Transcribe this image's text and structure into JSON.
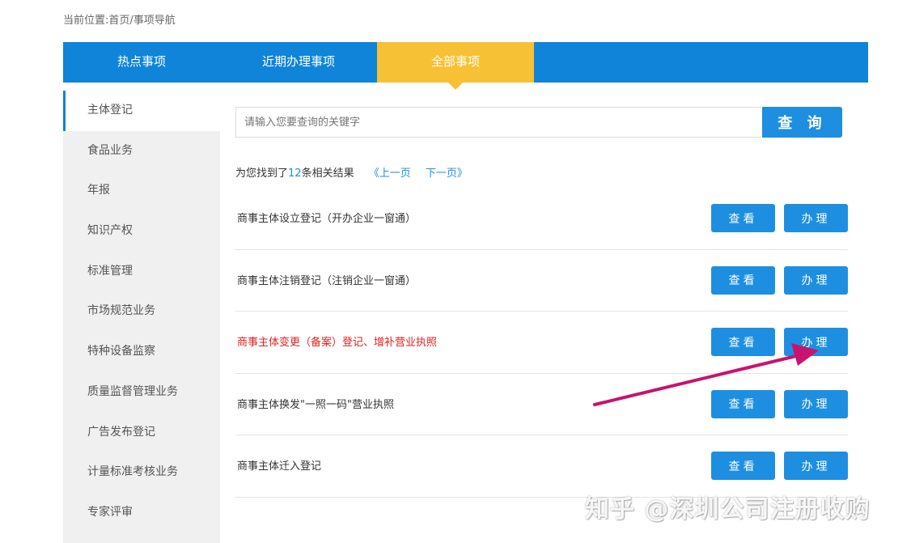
{
  "breadcrumb": "当前位置:首页/事项导航",
  "tabs": [
    {
      "label": "热点事项"
    },
    {
      "label": "近期办理事项"
    },
    {
      "label": "全部事项"
    }
  ],
  "sidebar": {
    "items": [
      {
        "label": "主体登记"
      },
      {
        "label": "食品业务"
      },
      {
        "label": "年报"
      },
      {
        "label": "知识产权"
      },
      {
        "label": "标准管理"
      },
      {
        "label": "市场规范业务"
      },
      {
        "label": "特种设备监察"
      },
      {
        "label": "质量监督管理业务"
      },
      {
        "label": "广告发布登记"
      },
      {
        "label": "计量标准考核业务"
      },
      {
        "label": "专家评审"
      }
    ]
  },
  "search": {
    "placeholder": "请输入您要查询的关键字",
    "button_label": "查 询"
  },
  "results": {
    "prefix": "为您找到了",
    "count": "12",
    "suffix": "条相关结果",
    "prev": "《上一页",
    "next": "下一页》"
  },
  "items": [
    {
      "title": "商事主体设立登记（开办企业一窗通）",
      "view": "查看",
      "handle": "办理"
    },
    {
      "title": "商事主体注销登记（注销企业一窗通）",
      "view": "查看",
      "handle": "办理"
    },
    {
      "title": "商事主体变更（备案）登记、增补营业执照",
      "view": "查看",
      "handle": "办理"
    },
    {
      "title": "商事主体换发\"一照一码\"营业执照",
      "view": "查看",
      "handle": "办理"
    },
    {
      "title": "商事主体迁入登记",
      "view": "查看",
      "handle": "办理"
    }
  ],
  "watermark": "知乎 @深圳公司注册收购",
  "colors": {
    "primary_blue": "#0f84d8",
    "button_blue": "#1e8fe0",
    "active_tab": "#f7c136",
    "highlight_red": "#e02020",
    "arrow": "#c8136f"
  }
}
